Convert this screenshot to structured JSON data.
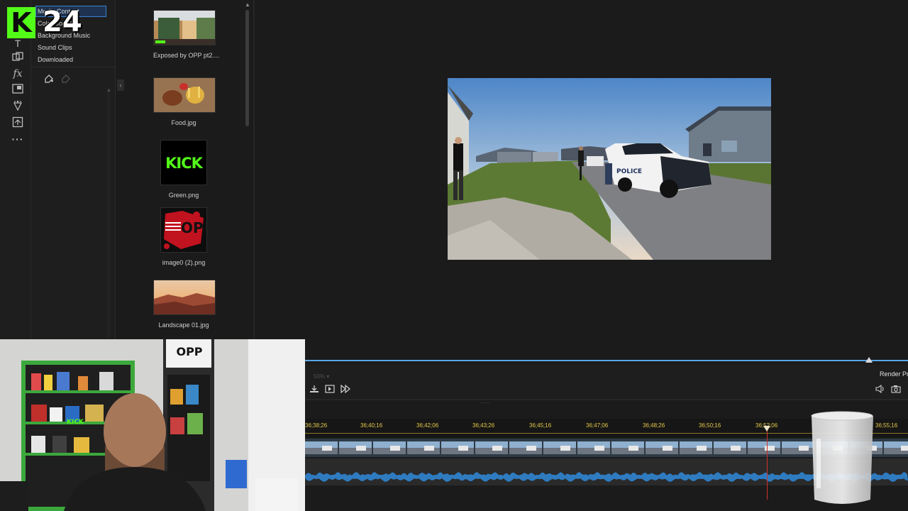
{
  "kick": {
    "logo_letter": "K",
    "count": "24",
    "brand_color": "#53fc18"
  },
  "rail": {
    "icons": [
      "media-room-icon",
      "title-room-icon",
      "transition-room-icon",
      "effects-room-icon",
      "pip-room-icon",
      "particle-room-icon",
      "template-room-icon",
      "more-icon"
    ]
  },
  "categories": {
    "items": [
      "Media Content",
      "Color Boards",
      "Background Music",
      "Sound Clips",
      "Downloaded"
    ],
    "selected": "Media Content"
  },
  "library": {
    "items": [
      {
        "label": "Exposed by OPP pt2....",
        "kind": "video"
      },
      {
        "label": "Food.jpg",
        "kind": "food"
      },
      {
        "label": "Green.png",
        "kind": "kick"
      },
      {
        "label": "image0 (2).png",
        "kind": "opp"
      },
      {
        "label": "Landscape 01.jpg",
        "kind": "landscape"
      }
    ],
    "kick_thumb_text": "KICK",
    "opp_thumb_text": "OPP!"
  },
  "playback": {
    "zoom": "50%",
    "render_label": "Render Preview"
  },
  "timeline": {
    "ticks": [
      "36;38;26",
      "36;40;16",
      "36;42;06",
      "36;43;26",
      "36;45;16",
      "36;47;06",
      "36;48;26",
      "36;50;16",
      "36;52;06",
      "36;55;16"
    ]
  },
  "webcam": {
    "poster_text": "OPP",
    "shelf_sign_text": "KICK"
  },
  "colors": {
    "accent": "#3d7fd1",
    "seek": "#5aa7e8",
    "tick": "#e6c84a",
    "playhead": "#d0312d"
  }
}
